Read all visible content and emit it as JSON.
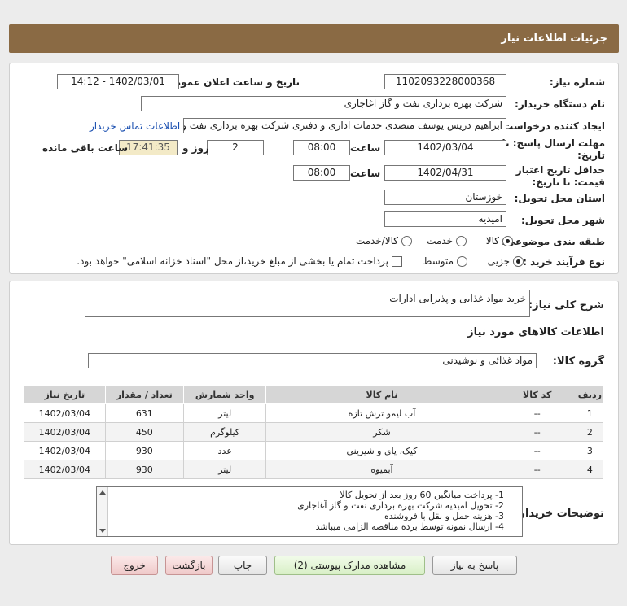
{
  "header": {
    "title": "جزئیات اطلاعات نیاز"
  },
  "form": {
    "need_number_label": "شماره نیاز:",
    "need_number": "1102093228000368",
    "announce_label": "تاریخ و ساعت اعلان عمومی:",
    "announce_value": "1402/03/01 - 14:12",
    "buyer_org_label": "نام دستگاه خریدار:",
    "buyer_org": "شرکت بهره برداری نفت و گاز اغاجاری",
    "creator_label": "ایجاد کننده درخواست:",
    "creator": "ابراهیم دریس یوسف متصدی خدمات اداری و دفتری شرکت بهره برداری نفت و گاز اغاجاری",
    "contact_link": "اطلاعات تماس خریدار",
    "deadline_label_1": "مهلت ارسال پاسخ: تا",
    "deadline_label_2": "تاریخ:",
    "deadline_date": "1402/03/04",
    "time_label": "ساعت",
    "deadline_time": "08:00",
    "days_value": "2",
    "days_label": "روز و",
    "remaining_time": "17:41:35",
    "remaining_label": "ساعت باقی مانده",
    "validity_label_1": "حداقل تاریخ اعتبار",
    "validity_label_2": "قیمت: تا تاریخ:",
    "validity_date": "1402/04/31",
    "validity_time": "08:00",
    "province_label": "استان محل تحویل:",
    "province": "خوزستان",
    "city_label": "شهر محل تحویل:",
    "city": "امیدیه",
    "category_label": "طبقه بندی موضوعی:",
    "category_options": [
      "کالا",
      "خدمت",
      "کالا/خدمت"
    ],
    "purchase_type_label": "نوع فرآیند خرید :",
    "purchase_options": [
      "جزیی",
      "متوسط"
    ],
    "payment_note": "پرداخت تمام یا بخشی از مبلغ خرید،از محل \"اسناد خزانه اسلامی\" خواهد بود."
  },
  "summary": {
    "label": "شرح کلی نیاز:",
    "value": "خرید مواد غذایی و پذیرایی ادارات",
    "goods_info_title": "اطلاعات کالاهای مورد نیاز",
    "group_label": "گروه کالا:",
    "group_value": "مواد غذائی و نوشیدنی"
  },
  "table": {
    "headers": [
      "ردیف",
      "کد کالا",
      "نام کالا",
      "واحد شمارش",
      "تعداد / مقدار",
      "تاریخ نیاز"
    ],
    "rows": [
      [
        "1",
        "--",
        "آب لیمو ترش تازه",
        "لیتر",
        "631",
        "1402/03/04"
      ],
      [
        "2",
        "--",
        "شکر",
        "کیلوگرم",
        "450",
        "1402/03/04"
      ],
      [
        "3",
        "--",
        "کیک، پای و شیرینی",
        "عدد",
        "930",
        "1402/03/04"
      ],
      [
        "4",
        "--",
        "آبمیوه",
        "لیتر",
        "930",
        "1402/03/04"
      ]
    ]
  },
  "notes": {
    "label": "توضیحات خریدار:",
    "lines": [
      "1- پرداخت میانگین 60 روز بعد از تحویل کالا",
      "2- تحویل امیدیه شرکت بهره برداری نفت و گاز آغاجاری",
      "3- هزینه حمل و نقل با فروشنده",
      "4- ارسال نمونه توسط برده مناقصه الزامی میباشد"
    ]
  },
  "buttons": {
    "reply": "پاسخ به نیاز",
    "attachments": "مشاهده مدارک پیوستی (2)",
    "print": "چاپ",
    "back": "بازگشت",
    "exit": "خروج"
  }
}
